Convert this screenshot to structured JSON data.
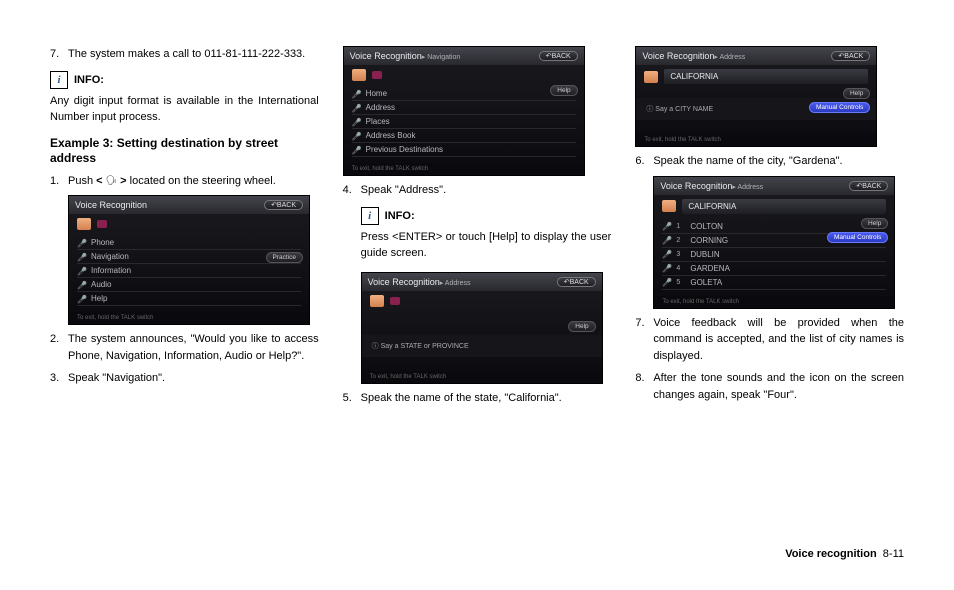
{
  "col1": {
    "step7_num": "7.",
    "step7_txt": "The system makes a call to 011-81-111-222-333.",
    "info_label": "INFO:",
    "info_body": "Any digit input format is available in the International Number input process.",
    "example_head": "Example 3: Setting destination by street address",
    "step1_num": "1.",
    "step1_txt_a": "Push ",
    "step1_txt_b": " located on the steering wheel.",
    "bracket_open": "<",
    "bracket_close": ">",
    "screenA": {
      "title": "Voice Recognition",
      "back": "↶BACK",
      "items": [
        "Phone",
        "Navigation",
        "Information",
        "Audio",
        "Help"
      ],
      "practice": "Practice",
      "foot": "To exit, hold the TALK switch"
    },
    "step2_num": "2.",
    "step2_txt": "The system announces, \"Would you like to access Phone, Navigation, Information, Audio or Help?\".",
    "step3_num": "3.",
    "step3_txt": "Speak \"Navigation\"."
  },
  "col2": {
    "screenB": {
      "title": "Voice Recognition",
      "sub": "▸ Navigation",
      "back": "↶BACK",
      "items": [
        "Home",
        "Address",
        "Places",
        "Address Book",
        "Previous Destinations"
      ],
      "help": "Help",
      "foot": "To exit, hold the TALK switch"
    },
    "step4_num": "4.",
    "step4_txt": "Speak \"Address\".",
    "info_label": "INFO:",
    "info_body": "Press <ENTER> or touch [Help] to display the user guide screen.",
    "screenC": {
      "title": "Voice Recognition",
      "sub": "▸ Address",
      "back": "↶BACK",
      "help": "Help",
      "prompt": "ⓘ Say a STATE or PROVINCE",
      "foot": "To exit, hold the TALK switch"
    },
    "step5_num": "5.",
    "step5_txt": "Speak the name of the state, \"California\"."
  },
  "col3": {
    "screenD": {
      "title": "Voice Recognition",
      "sub": "▸ Address",
      "back": "↶BACK",
      "selected": "CALIFORNIA",
      "help": "Help",
      "manual": "Manual Controls",
      "prompt": "ⓘ Say a CITY NAME",
      "foot": "To exit, hold the TALK switch"
    },
    "step6_num": "6.",
    "step6_txt": "Speak the name of the city, \"Gardena\".",
    "screenE": {
      "title": "Voice Recognition",
      "sub": "▸ Address",
      "back": "↶BACK",
      "selected": "CALIFORNIA",
      "items": [
        {
          "n": "1",
          "t": "COLTON"
        },
        {
          "n": "2",
          "t": "CORNING"
        },
        {
          "n": "3",
          "t": "DUBLIN"
        },
        {
          "n": "4",
          "t": "GARDENA"
        },
        {
          "n": "5",
          "t": "GOLETA"
        }
      ],
      "help": "Help",
      "manual": "Manual Controls",
      "foot": "To exit, hold the TALK switch"
    },
    "step7_num": "7.",
    "step7_txt": "Voice feedback will be provided when the command is accepted, and the list of city names is displayed.",
    "step8_num": "8.",
    "step8_txt": "After the tone sounds and the icon on the screen changes again, speak \"Four\"."
  },
  "footer": {
    "section": "Voice recognition",
    "page": "8-11"
  }
}
